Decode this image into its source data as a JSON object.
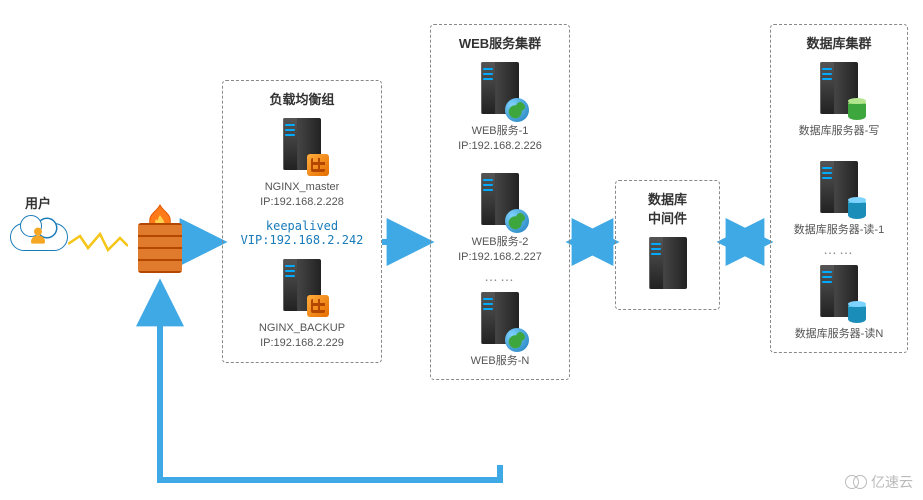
{
  "user": {
    "label": "用户"
  },
  "loadbalancer": {
    "title": "负载均衡组",
    "nodes": [
      {
        "name": "NGINX_master",
        "ip": "IP:192.168.2.228"
      },
      {
        "name": "NGINX_BACKUP",
        "ip": "IP:192.168.2.229"
      }
    ],
    "keepalived_line1": "keepalived",
    "keepalived_line2": "VIP:192.168.2.242"
  },
  "web": {
    "title": "WEB服务集群",
    "nodes": [
      {
        "name": "WEB服务-1",
        "ip": "IP:192.168.2.226"
      },
      {
        "name": "WEB服务-2",
        "ip": "IP:192.168.2.227"
      },
      {
        "name": "WEB服务-N",
        "ip": ""
      }
    ]
  },
  "middleware": {
    "title": "数据库\n中间件"
  },
  "db": {
    "title": "数据库集群",
    "nodes": [
      {
        "name": "数据库服务器-写"
      },
      {
        "name": "数据库服务器-读-1"
      },
      {
        "name": "数据库服务器-读N"
      }
    ]
  },
  "watermark": "亿速云"
}
